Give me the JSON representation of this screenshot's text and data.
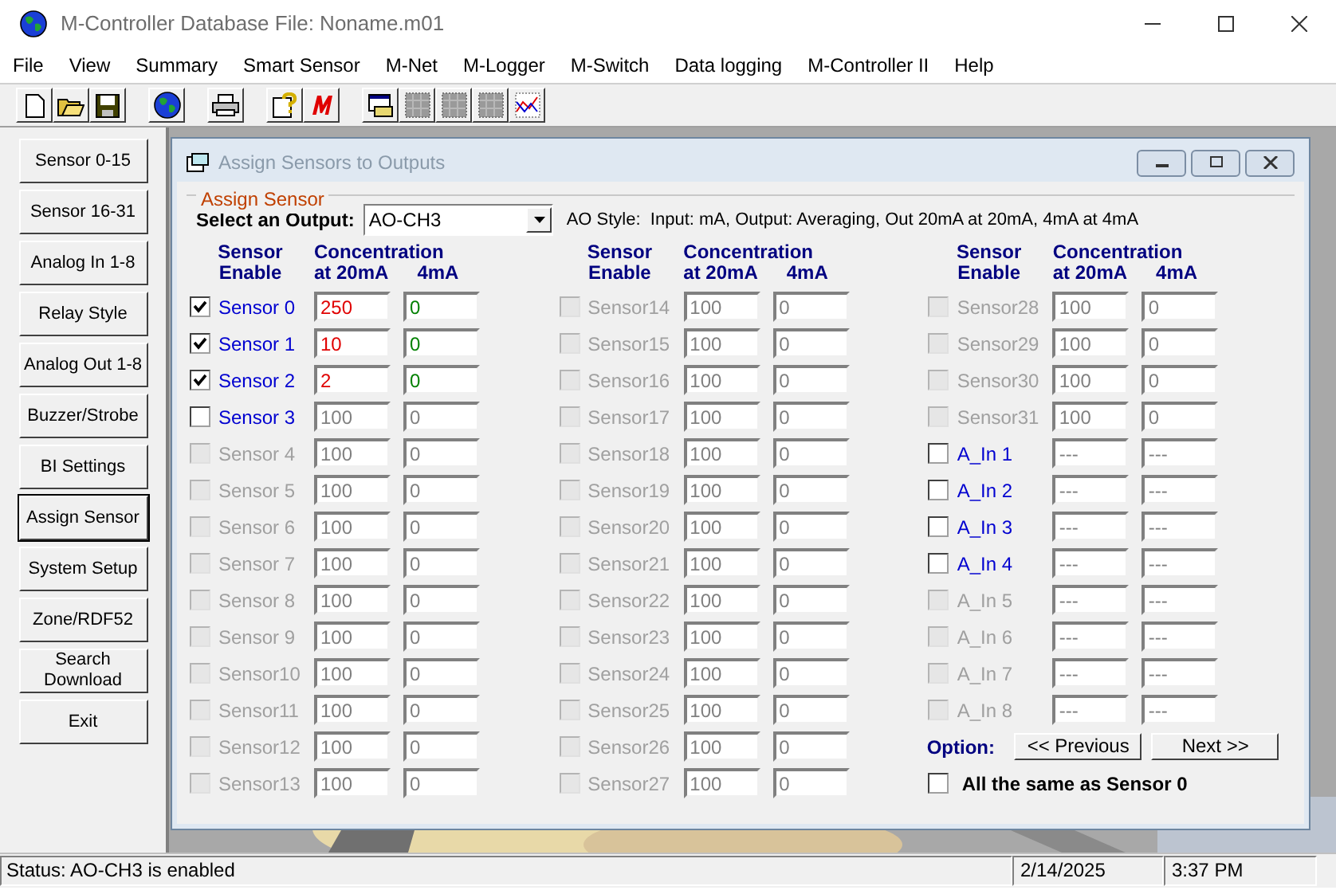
{
  "window": {
    "title": "M-Controller Database File: Noname.m01"
  },
  "menu": [
    "File",
    "View",
    "Summary",
    "Smart Sensor",
    "M-Net",
    "M-Logger",
    "M-Switch",
    "Data logging",
    "M-Controller II",
    "Help"
  ],
  "sidebar": [
    {
      "label": "Sensor 0-15",
      "selected": false
    },
    {
      "label": "Sensor 16-31",
      "selected": false
    },
    {
      "label": "Analog In 1-8",
      "selected": false
    },
    {
      "label": "Relay Style",
      "selected": false
    },
    {
      "label": "Analog Out 1-8",
      "selected": false
    },
    {
      "label": "Buzzer/Strobe",
      "selected": false
    },
    {
      "label": "BI Settings",
      "selected": false
    },
    {
      "label": "Assign Sensor",
      "selected": true
    },
    {
      "label": "System Setup",
      "selected": false
    },
    {
      "label": "Zone/RDF52",
      "selected": false
    },
    {
      "label": "Search Download",
      "selected": false
    },
    {
      "label": "Exit",
      "selected": false
    }
  ],
  "dialog": {
    "title": "Assign Sensors to Outputs",
    "group_title": "Assign Sensor",
    "output_label": "Select an Output:",
    "output_value": "AO-CH3",
    "ao_style": "AO Style:  Input: mA, Output: Averaging, Out 20mA at 20mA, 4mA at 4mA",
    "columns": [
      {
        "header_sensor": "Sensor",
        "header_enable": "Enable",
        "header_concentration": "Concentration",
        "header_20ma": "at 20mA",
        "header_4ma": "4mA",
        "rows": [
          {
            "label": "Sensor 0",
            "checked": true,
            "disabled": false,
            "at_20ma": "250",
            "at_4ma": "0"
          },
          {
            "label": "Sensor 1",
            "checked": true,
            "disabled": false,
            "at_20ma": "10",
            "at_4ma": "0"
          },
          {
            "label": "Sensor 2",
            "checked": true,
            "disabled": false,
            "at_20ma": "2",
            "at_4ma": "0"
          },
          {
            "label": "Sensor 3",
            "checked": false,
            "disabled": false,
            "at_20ma": "100",
            "at_4ma": "0"
          },
          {
            "label": "Sensor 4",
            "checked": false,
            "disabled": true,
            "at_20ma": "100",
            "at_4ma": "0"
          },
          {
            "label": "Sensor 5",
            "checked": false,
            "disabled": true,
            "at_20ma": "100",
            "at_4ma": "0"
          },
          {
            "label": "Sensor 6",
            "checked": false,
            "disabled": true,
            "at_20ma": "100",
            "at_4ma": "0"
          },
          {
            "label": "Sensor 7",
            "checked": false,
            "disabled": true,
            "at_20ma": "100",
            "at_4ma": "0"
          },
          {
            "label": "Sensor 8",
            "checked": false,
            "disabled": true,
            "at_20ma": "100",
            "at_4ma": "0"
          },
          {
            "label": "Sensor 9",
            "checked": false,
            "disabled": true,
            "at_20ma": "100",
            "at_4ma": "0"
          },
          {
            "label": "Sensor10",
            "checked": false,
            "disabled": true,
            "at_20ma": "100",
            "at_4ma": "0"
          },
          {
            "label": "Sensor11",
            "checked": false,
            "disabled": true,
            "at_20ma": "100",
            "at_4ma": "0"
          },
          {
            "label": "Sensor12",
            "checked": false,
            "disabled": true,
            "at_20ma": "100",
            "at_4ma": "0"
          },
          {
            "label": "Sensor13",
            "checked": false,
            "disabled": true,
            "at_20ma": "100",
            "at_4ma": "0"
          }
        ]
      },
      {
        "header_sensor": "Sensor",
        "header_enable": "Enable",
        "header_concentration": "Concentration",
        "header_20ma": "at 20mA",
        "header_4ma": "4mA",
        "rows": [
          {
            "label": "Sensor14",
            "checked": false,
            "disabled": true,
            "at_20ma": "100",
            "at_4ma": "0"
          },
          {
            "label": "Sensor15",
            "checked": false,
            "disabled": true,
            "at_20ma": "100",
            "at_4ma": "0"
          },
          {
            "label": "Sensor16",
            "checked": false,
            "disabled": true,
            "at_20ma": "100",
            "at_4ma": "0"
          },
          {
            "label": "Sensor17",
            "checked": false,
            "disabled": true,
            "at_20ma": "100",
            "at_4ma": "0"
          },
          {
            "label": "Sensor18",
            "checked": false,
            "disabled": true,
            "at_20ma": "100",
            "at_4ma": "0"
          },
          {
            "label": "Sensor19",
            "checked": false,
            "disabled": true,
            "at_20ma": "100",
            "at_4ma": "0"
          },
          {
            "label": "Sensor20",
            "checked": false,
            "disabled": true,
            "at_20ma": "100",
            "at_4ma": "0"
          },
          {
            "label": "Sensor21",
            "checked": false,
            "disabled": true,
            "at_20ma": "100",
            "at_4ma": "0"
          },
          {
            "label": "Sensor22",
            "checked": false,
            "disabled": true,
            "at_20ma": "100",
            "at_4ma": "0"
          },
          {
            "label": "Sensor23",
            "checked": false,
            "disabled": true,
            "at_20ma": "100",
            "at_4ma": "0"
          },
          {
            "label": "Sensor24",
            "checked": false,
            "disabled": true,
            "at_20ma": "100",
            "at_4ma": "0"
          },
          {
            "label": "Sensor25",
            "checked": false,
            "disabled": true,
            "at_20ma": "100",
            "at_4ma": "0"
          },
          {
            "label": "Sensor26",
            "checked": false,
            "disabled": true,
            "at_20ma": "100",
            "at_4ma": "0"
          },
          {
            "label": "Sensor27",
            "checked": false,
            "disabled": true,
            "at_20ma": "100",
            "at_4ma": "0"
          }
        ]
      },
      {
        "header_sensor": "Sensor",
        "header_enable": "Enable",
        "header_concentration": "Concentration",
        "header_20ma": "at 20mA",
        "header_4ma": "4mA",
        "rows": [
          {
            "label": "Sensor28",
            "checked": false,
            "disabled": true,
            "at_20ma": "100",
            "at_4ma": "0"
          },
          {
            "label": "Sensor29",
            "checked": false,
            "disabled": true,
            "at_20ma": "100",
            "at_4ma": "0"
          },
          {
            "label": "Sensor30",
            "checked": false,
            "disabled": true,
            "at_20ma": "100",
            "at_4ma": "0"
          },
          {
            "label": "Sensor31",
            "checked": false,
            "disabled": true,
            "at_20ma": "100",
            "at_4ma": "0"
          },
          {
            "label": "A_In 1",
            "checked": false,
            "disabled": false,
            "at_20ma": "---",
            "at_4ma": "---"
          },
          {
            "label": "A_In 2",
            "checked": false,
            "disabled": false,
            "at_20ma": "---",
            "at_4ma": "---"
          },
          {
            "label": "A_In 3",
            "checked": false,
            "disabled": false,
            "at_20ma": "---",
            "at_4ma": "---"
          },
          {
            "label": "A_In 4",
            "checked": false,
            "disabled": false,
            "at_20ma": "---",
            "at_4ma": "---"
          },
          {
            "label": "A_In 5",
            "checked": false,
            "disabled": true,
            "at_20ma": "---",
            "at_4ma": "---"
          },
          {
            "label": "A_In 6",
            "checked": false,
            "disabled": true,
            "at_20ma": "---",
            "at_4ma": "---"
          },
          {
            "label": "A_In 7",
            "checked": false,
            "disabled": true,
            "at_20ma": "---",
            "at_4ma": "---"
          },
          {
            "label": "A_In 8",
            "checked": false,
            "disabled": true,
            "at_20ma": "---",
            "at_4ma": "---"
          }
        ]
      }
    ],
    "option_label": "Option:",
    "buttons": [
      "<< Previous",
      "Next >>"
    ],
    "same_as": {
      "label": "All the same as Sensor 0",
      "checked": false
    }
  },
  "status_bar": {
    "status": "Status: AO-CH3 is enabled",
    "date": "2/14/2025",
    "time": "3:37 PM"
  }
}
